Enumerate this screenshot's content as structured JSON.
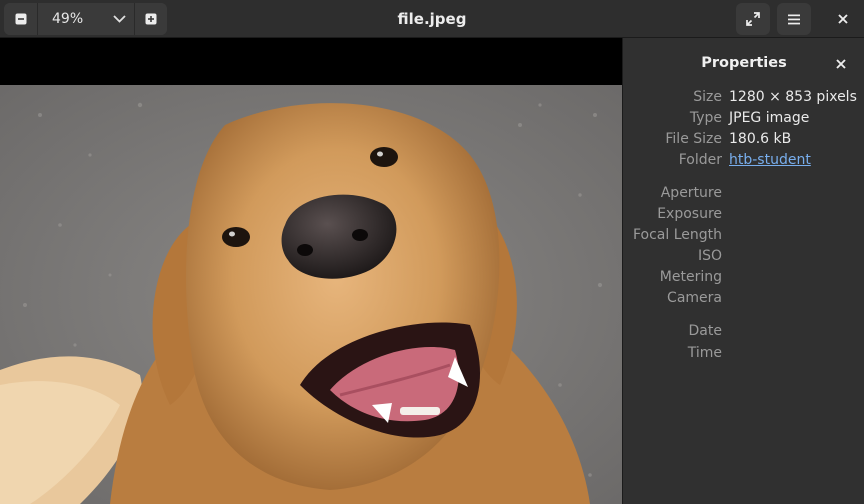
{
  "header": {
    "zoom_value": "49%",
    "title": "file.jpeg",
    "icons": {
      "zoom_out": "minus-square-icon",
      "zoom_dropdown": "chevron-down-icon",
      "zoom_in": "plus-square-icon",
      "fullscreen": "fullscreen-icon",
      "menu": "hamburger-menu-icon",
      "close": "close-icon"
    }
  },
  "sidebar": {
    "title": "Properties",
    "close_icon": "close-icon",
    "props": {
      "size": {
        "label": "Size",
        "value": "1280 × 853 pixels"
      },
      "type": {
        "label": "Type",
        "value": "JPEG image"
      },
      "file_size": {
        "label": "File Size",
        "value": "180.6 kB"
      },
      "folder": {
        "label": "Folder",
        "value": "htb-student"
      },
      "aperture": {
        "label": "Aperture",
        "value": ""
      },
      "exposure": {
        "label": "Exposure",
        "value": ""
      },
      "focal_length": {
        "label": "Focal Length",
        "value": ""
      },
      "iso": {
        "label": "ISO",
        "value": ""
      },
      "metering": {
        "label": "Metering",
        "value": ""
      },
      "camera": {
        "label": "Camera",
        "value": ""
      },
      "date": {
        "label": "Date",
        "value": ""
      },
      "time": {
        "label": "Time",
        "value": ""
      }
    }
  },
  "colors": {
    "headerbar": "#2e2e2e",
    "sidebar": "#303030",
    "viewer_bg": "#000000",
    "link": "#78aeed",
    "label": "#9a9a9a"
  }
}
